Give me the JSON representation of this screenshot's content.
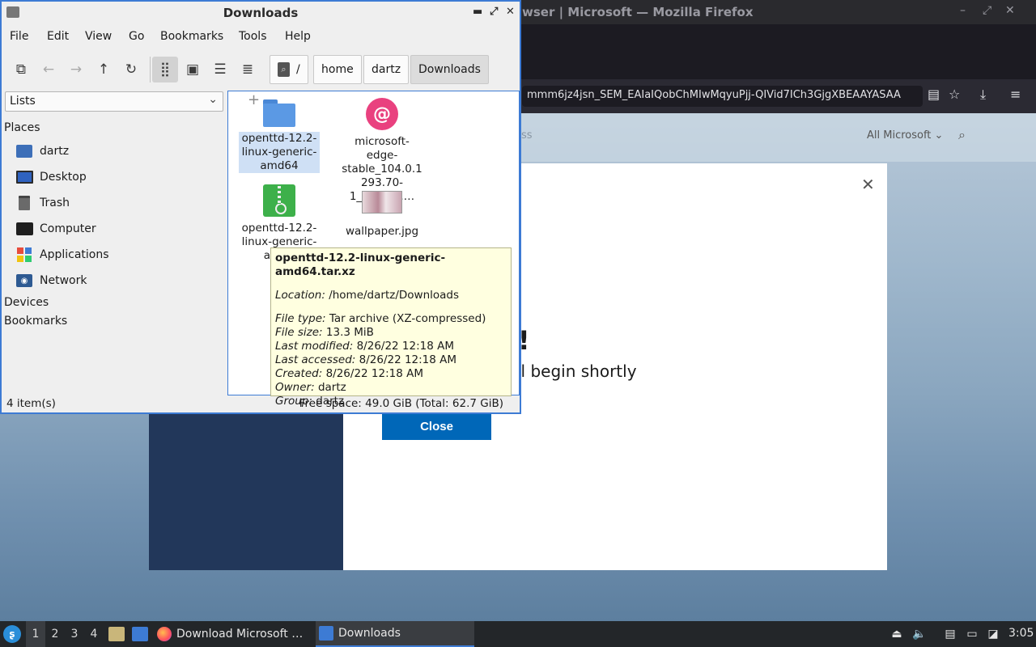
{
  "firefox": {
    "title": "wser | Microsoft — Mozilla Firefox",
    "url": "mmm6jz4jsn_SEM_EAIaIQobChMIwMqyuPjj-QIVid7ICh3GjgXBEAAYASAA",
    "page": {
      "header_fade": "ss",
      "all_microsoft": "All Microsoft",
      "exclaim": "!",
      "subtitle": "ll begin shortly",
      "close_label": "Close"
    }
  },
  "thunar": {
    "title": "Downloads",
    "menu": [
      "File",
      "Edit",
      "View",
      "Go",
      "Bookmarks",
      "Tools",
      "Help"
    ],
    "path": [
      "/",
      "home",
      "dartz",
      "Downloads"
    ],
    "side_select": "Lists",
    "places_header": "Places",
    "places": [
      "dartz",
      "Desktop",
      "Trash",
      "Computer",
      "Applications",
      "Network"
    ],
    "devices_header": "Devices",
    "bookmarks_header": "Bookmarks",
    "files": [
      {
        "name": "openttd-12.2-linux-generic-amd64",
        "icon": "folder-icon"
      },
      {
        "name": "microsoft-edge-stable_104.0.1293.70-1_amd64.…",
        "icon": "debian-package-icon"
      },
      {
        "name": "openttd-12.2-linux-generic-amd6",
        "icon": "archive-icon"
      },
      {
        "name": "wallpaper.jpg",
        "icon": "image-thumbnail"
      }
    ],
    "status_count": "4 item(s)",
    "status_free": "Free space: 49.0 GiB (Total: 62.7 GiB)"
  },
  "tooltip": {
    "filename": "openttd-12.2-linux-generic-amd64.tar.xz",
    "rows": [
      {
        "label": "Location:",
        "value": "/home/dartz/Downloads"
      },
      {
        "label": "File type:",
        "value": "Tar archive (XZ-compressed)"
      },
      {
        "label": "File size:",
        "value": "13.3 MiB"
      },
      {
        "label": "Last modified:",
        "value": "8/26/22 12:18 AM"
      },
      {
        "label": "Last accessed:",
        "value": "8/26/22 12:18 AM"
      },
      {
        "label": "Created:",
        "value": "8/26/22 12:18 AM"
      },
      {
        "label": "Owner:",
        "value": "dartz"
      },
      {
        "label": "Group:",
        "value": "dartz"
      }
    ]
  },
  "taskbar": {
    "workspaces": [
      "1",
      "2",
      "3",
      "4"
    ],
    "tasks": [
      "Download Microsoft …",
      "Downloads"
    ],
    "clock": "3:05"
  }
}
